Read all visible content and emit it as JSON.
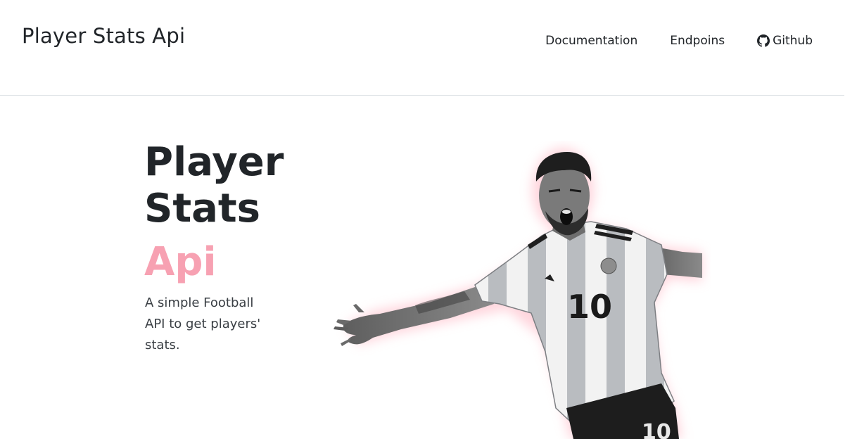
{
  "navbar": {
    "brand": "Player Stats Api",
    "links": [
      {
        "label": "Documentation"
      },
      {
        "label": "Endpoins"
      },
      {
        "label": "Github",
        "icon": "github-icon"
      }
    ]
  },
  "hero": {
    "title_line1": "Player",
    "title_line2": "Stats",
    "title_accent": "Api",
    "description": "A simple Football API to get players' stats.",
    "accent_color": "#f7a1b2",
    "image": {
      "icon": "football-player-image",
      "jersey_number": "10"
    }
  }
}
